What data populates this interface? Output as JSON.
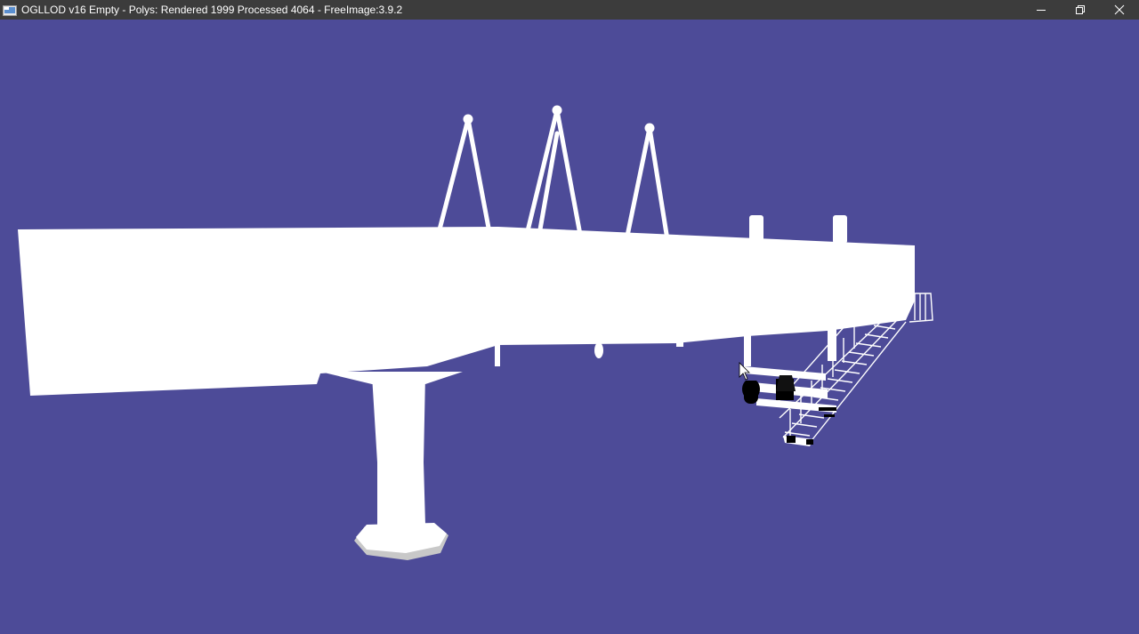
{
  "window": {
    "title": "OGLLOD v16 Empty  -  Polys: Rendered 1999  Processed 4064  -  FreeImage:3.9.2",
    "icons": {
      "app": "app-window-icon",
      "minimize": "minimize-icon",
      "restore": "restore-icon",
      "close": "close-icon",
      "cursor": "mouse-pointer-icon"
    }
  },
  "scene": {
    "background_color": "#4d4b98",
    "model_color": "#ffffff",
    "model": "white 3D model of a cable-stayed bridge span with a pier, three cable pylons, and a stair/railing section"
  }
}
